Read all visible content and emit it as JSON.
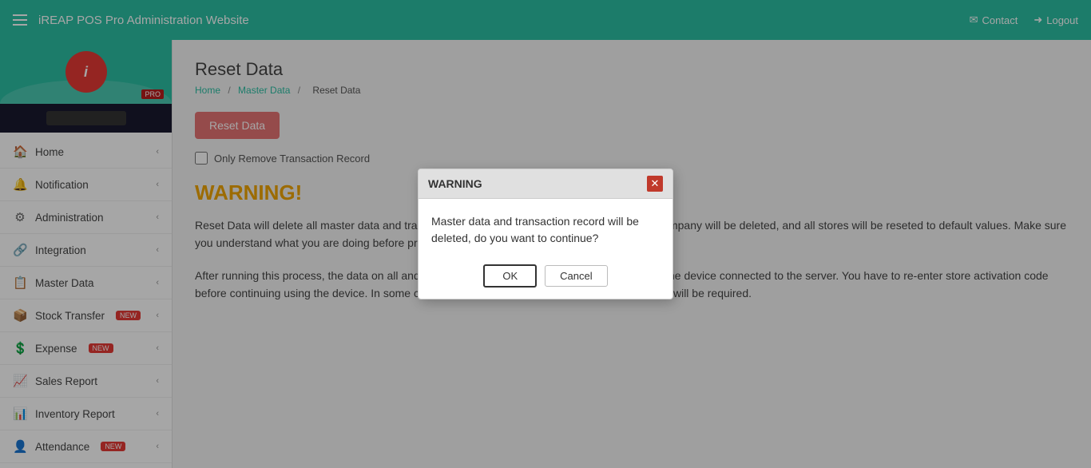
{
  "navbar": {
    "hamburger_label": "menu",
    "title": "iREAP POS Pro Administration Website",
    "contact_label": "Contact",
    "logout_label": "Logout"
  },
  "sidebar": {
    "logo_text": "i",
    "pro_badge": "PRO",
    "items": [
      {
        "id": "home",
        "icon": "🏠",
        "label": "Home",
        "arrow": true,
        "badge": null
      },
      {
        "id": "notification",
        "icon": "🔔",
        "label": "Notification",
        "arrow": true,
        "badge": null
      },
      {
        "id": "administration",
        "icon": "⚙",
        "label": "Administration",
        "arrow": true,
        "badge": null
      },
      {
        "id": "integration",
        "icon": "🔗",
        "label": "Integration",
        "arrow": true,
        "badge": null
      },
      {
        "id": "master-data",
        "icon": "📋",
        "label": "Master Data",
        "arrow": true,
        "badge": null
      },
      {
        "id": "stock-transfer",
        "icon": "📦",
        "label": "Stock Transfer",
        "arrow": true,
        "badge": "NEW"
      },
      {
        "id": "expense",
        "icon": "💲",
        "label": "Expense",
        "arrow": true,
        "badge": "NEW"
      },
      {
        "id": "sales-report",
        "icon": "📈",
        "label": "Sales Report",
        "arrow": true,
        "badge": null
      },
      {
        "id": "inventory-report",
        "icon": "📊",
        "label": "Inventory Report",
        "arrow": true,
        "badge": null
      },
      {
        "id": "attendance",
        "icon": "👤",
        "label": "Attendance",
        "arrow": true,
        "badge": "NEW"
      }
    ]
  },
  "page": {
    "title": "Reset Data",
    "breadcrumb": {
      "home": "Home",
      "master_data": "Master Data",
      "current": "Reset Data"
    },
    "reset_button_label": "Reset Data",
    "only_remove_label": "Only Remove Transaction Record",
    "warning_heading": "WARNING!",
    "warning_text1": "Reset Data will delete all master data and transaction records. All devices information in your company will be deleted, and all stores will be reseted to default values. Make sure you understand what you are doing before proceeding.",
    "warning_text2": "After running this process, the data on all android devices in the company will be deleted when the device connected to the server. You have to re-enter store activation code before continuing using the device. In some cases uninstall and reinstallation of iREAP POS Pro will be required."
  },
  "modal": {
    "title": "WARNING",
    "message": "Master data and transaction record will be deleted, do you want to continue?",
    "ok_label": "OK",
    "cancel_label": "Cancel"
  }
}
